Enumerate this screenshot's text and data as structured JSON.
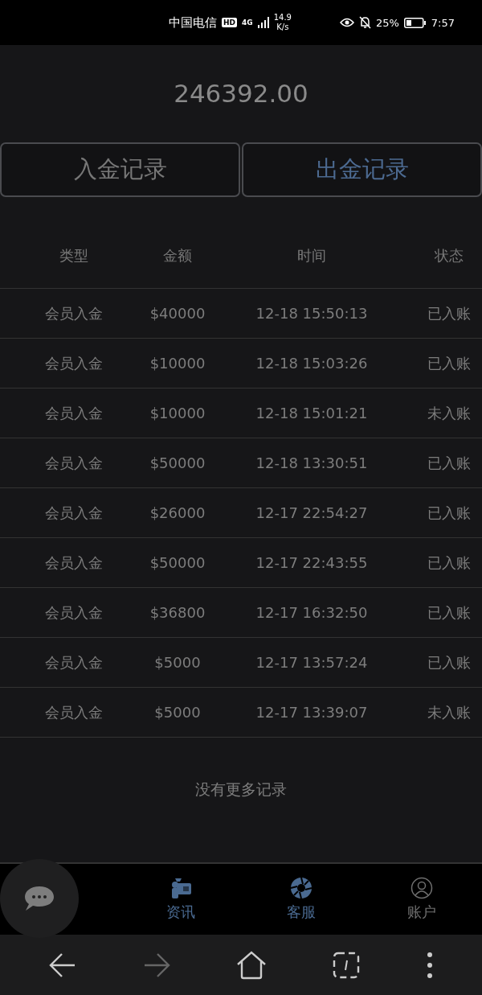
{
  "status_bar": {
    "carrier": "中国电信",
    "hd": "HD",
    "network": "4G",
    "speed_value": "14.9",
    "speed_unit": "K/s",
    "battery_percent": "25%",
    "time": "7:57"
  },
  "balance": "246392.00",
  "tabs": [
    {
      "label": "入金记录",
      "selected": false
    },
    {
      "label": "出金记录",
      "selected": true
    }
  ],
  "table": {
    "columns": [
      "类型",
      "金额",
      "时间",
      "状态"
    ],
    "rows": [
      [
        "会员入金",
        "$40000",
        "12-18 15:50:13",
        "已入账"
      ],
      [
        "会员入金",
        "$10000",
        "12-18 15:03:26",
        "已入账"
      ],
      [
        "会员入金",
        "$10000",
        "12-18 15:01:21",
        "未入账"
      ],
      [
        "会员入金",
        "$50000",
        "12-18 13:30:51",
        "已入账"
      ],
      [
        "会员入金",
        "$26000",
        "12-17 22:54:27",
        "已入账"
      ],
      [
        "会员入金",
        "$50000",
        "12-17 22:43:55",
        "已入账"
      ],
      [
        "会员入金",
        "$36800",
        "12-17 16:32:50",
        "已入账"
      ],
      [
        "会员入金",
        "$5000",
        "12-17 13:57:24",
        "已入账"
      ],
      [
        "会员入金",
        "$5000",
        "12-17 13:39:07",
        "未入账"
      ]
    ]
  },
  "footer_note": "没有更多记录",
  "bottom_nav": [
    {
      "label": "资讯",
      "active": true
    },
    {
      "label": "客服",
      "active": true
    },
    {
      "label": "账户",
      "active": false
    }
  ]
}
